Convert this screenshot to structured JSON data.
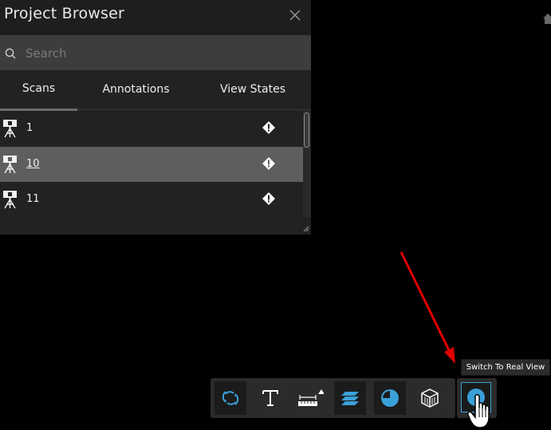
{
  "panel": {
    "title": "Project Browser",
    "search_placeholder": "Search",
    "tabs": [
      {
        "label": "Scans",
        "active": true
      },
      {
        "label": "Annotations"
      },
      {
        "label": "View States"
      }
    ],
    "rows": [
      {
        "name": "1",
        "selected": false
      },
      {
        "name": "10",
        "selected": true
      },
      {
        "name": "11",
        "selected": false
      }
    ]
  },
  "tooltip": "Switch To Real View",
  "toolbar": {
    "tools": [
      "orbit-icon",
      "text-icon",
      "measure-icon",
      "layers-icon",
      "clipping-icon",
      "box-icon"
    ],
    "real_view": "real-view-icon"
  },
  "colors": {
    "accent": "#3aa0d8",
    "arrow": "#e00000"
  }
}
